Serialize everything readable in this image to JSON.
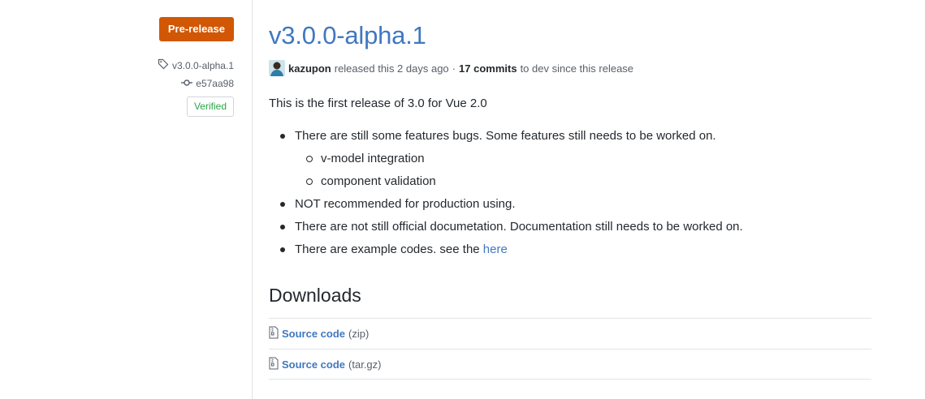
{
  "sidebar": {
    "badge": "Pre-release",
    "tag": "v3.0.0-alpha.1",
    "commit": "e57aa98",
    "verified": "Verified"
  },
  "release": {
    "title": "v3.0.0-alpha.1",
    "author": "kazupon",
    "released_text": "released this 2 days ago",
    "separator": "·",
    "commits": "17 commits",
    "commits_suffix": "to dev since this release"
  },
  "body": {
    "intro": "This is the first release of 3.0 for Vue 2.0",
    "items": [
      "There are still some features bugs. Some features still needs to be worked on.",
      "v-model integration",
      "component validation",
      "NOT recommended for production using.",
      "There are not still official documetation. Documentation still needs to be worked on.",
      "There are example codes. see the"
    ],
    "here_link": "here"
  },
  "downloads": {
    "heading": "Downloads",
    "assets": [
      {
        "name": "Source code",
        "format": "(zip)"
      },
      {
        "name": "Source code",
        "format": "(tar.gz)"
      }
    ]
  },
  "colors": {
    "badge": "#d15704",
    "link": "#4078c0",
    "verified": "#28a745"
  },
  "icons": {
    "tag": "tag-icon",
    "commit": "git-commit-icon",
    "archive": "file-zip-icon"
  }
}
